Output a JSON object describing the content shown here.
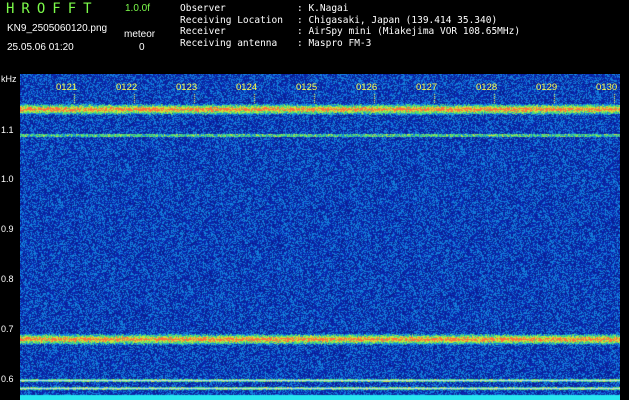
{
  "header": {
    "brand": "HROFFT",
    "version": "1.0.0f",
    "filename": "KN9_2505060120.png",
    "datetime": "25.05.06 01:20",
    "meteor_label": "meteor",
    "meteor_count": "0"
  },
  "info": [
    {
      "key": "Observer",
      "value": ": K.Nagai"
    },
    {
      "key": "Receiving Location",
      "value": ": Chigasaki, Japan (139.414 35.340)"
    },
    {
      "key": "Receiver",
      "value": ": AirSpy mini (Miakejima VOR 108.65MHz)"
    },
    {
      "key": "Receiving antenna",
      "value": ": Maspro FM-3"
    }
  ],
  "y_axis": {
    "unit": "kHz",
    "labels": [
      "1.1",
      "1.0",
      "0.9",
      "0.8",
      "0.7",
      "0.6"
    ]
  },
  "time_axis": {
    "labels": [
      "0121",
      "0122",
      "0123",
      "0124",
      "0125",
      "0126",
      "0127",
      "0128",
      "0129",
      "0130"
    ]
  },
  "colors": {
    "background": "#000000",
    "noise_base": "#1a2aa8",
    "signal_band": "#ff6a3c",
    "echo_band": "#7de64a",
    "text_accent": "#7CFC4A",
    "tick_label": "#FFFF4A"
  },
  "chart_data": {
    "type": "heatmap",
    "x_labels": [
      "0121",
      "0122",
      "0123",
      "0124",
      "0125",
      "0126",
      "0127",
      "0128",
      "0129",
      "0130"
    ],
    "y_unit": "kHz",
    "ylim": [
      0.58,
      1.14
    ],
    "y_ticks": [
      0.6,
      0.7,
      0.8,
      0.9,
      1.0,
      1.1
    ],
    "bands_khz": [
      1.08,
      1.035,
      0.685,
      0.615,
      0.6
    ],
    "strong_bands_khz": [
      1.08,
      0.685
    ]
  }
}
